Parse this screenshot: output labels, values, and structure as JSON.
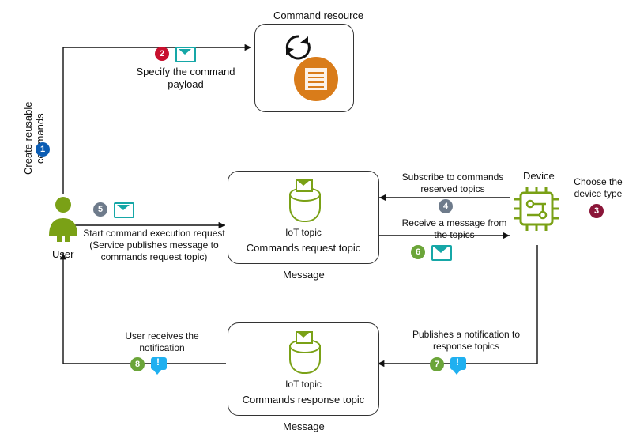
{
  "user": {
    "label": "User"
  },
  "device": {
    "label": "Device"
  },
  "command_resource": {
    "title": "Command resource"
  },
  "topic_request": {
    "icon_label": "IoT topic",
    "title": "Commands request topic",
    "subtitle": "Message"
  },
  "topic_response": {
    "icon_label": "IoT topic",
    "title": "Commands response topic",
    "subtitle": "Message"
  },
  "steps": {
    "1": {
      "num": "1",
      "color": "#0B5CB3",
      "label": "Create reusable commands"
    },
    "2": {
      "num": "2",
      "color": "#C8102E",
      "label": "Specify the command payload"
    },
    "3": {
      "num": "3",
      "color": "#8A1538",
      "label": "Choose the device type"
    },
    "4": {
      "num": "4",
      "color": "#6E7B8B",
      "label": "Subscribe to commands reserved topics"
    },
    "5": {
      "num": "5",
      "color": "#6E7B8B",
      "label": "Start command execution request (Service publishes message to commands request topic)"
    },
    "6": {
      "num": "6",
      "color": "#6BA539",
      "label": "Receive a message from the topics"
    },
    "7": {
      "num": "7",
      "color": "#6BA539",
      "label": "Publishes a notification to response topics"
    },
    "8": {
      "num": "8",
      "color": "#6BA539",
      "label": "User receives the notification"
    }
  }
}
